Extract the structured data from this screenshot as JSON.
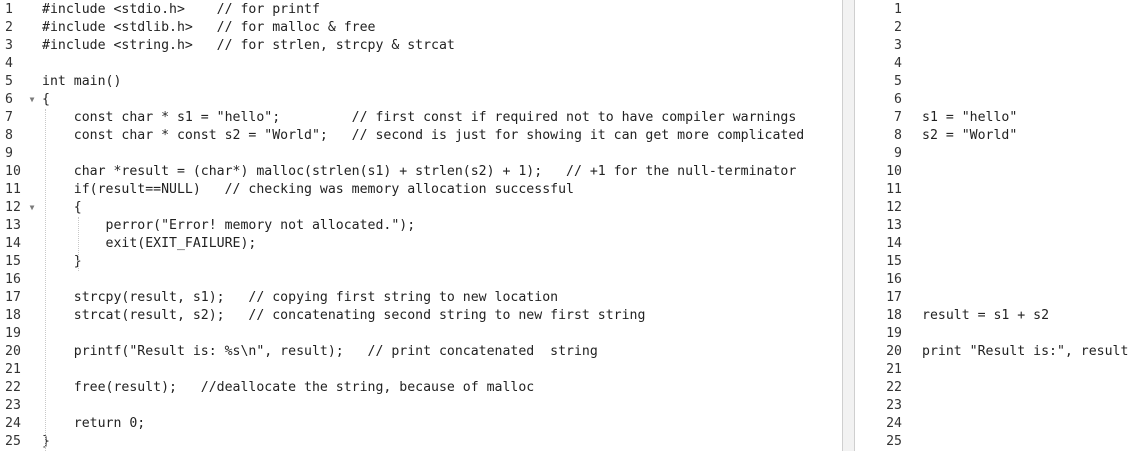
{
  "left_editor": {
    "lines": [
      {
        "num": "1",
        "text": "#include <stdio.h>    // for printf",
        "fold": ""
      },
      {
        "num": "2",
        "text": "#include <stdlib.h>   // for malloc & free",
        "fold": ""
      },
      {
        "num": "3",
        "text": "#include <string.h>   // for strlen, strcpy & strcat",
        "fold": ""
      },
      {
        "num": "4",
        "text": "",
        "fold": ""
      },
      {
        "num": "5",
        "text": "int main()",
        "fold": ""
      },
      {
        "num": "6",
        "text": "{",
        "fold": "▼"
      },
      {
        "num": "7",
        "text": "    const char * s1 = \"hello\";         // first const if required not to have compiler warnings",
        "fold": ""
      },
      {
        "num": "8",
        "text": "    const char * const s2 = \"World\";   // second is just for showing it can get more complicated",
        "fold": ""
      },
      {
        "num": "9",
        "text": "",
        "fold": ""
      },
      {
        "num": "10",
        "text": "    char *result = (char*) malloc(strlen(s1) + strlen(s2) + 1);   // +1 for the null-terminator",
        "fold": ""
      },
      {
        "num": "11",
        "text": "    if(result==NULL)   // checking was memory allocation successful",
        "fold": ""
      },
      {
        "num": "12",
        "text": "    {",
        "fold": "▼"
      },
      {
        "num": "13",
        "text": "        perror(\"Error! memory not allocated.\");",
        "fold": ""
      },
      {
        "num": "14",
        "text": "        exit(EXIT_FAILURE);",
        "fold": ""
      },
      {
        "num": "15",
        "text": "    }",
        "fold": ""
      },
      {
        "num": "16",
        "text": "",
        "fold": ""
      },
      {
        "num": "17",
        "text": "    strcpy(result, s1);   // copying first string to new location",
        "fold": ""
      },
      {
        "num": "18",
        "text": "    strcat(result, s2);   // concatenating second string to new first string",
        "fold": ""
      },
      {
        "num": "19",
        "text": "",
        "fold": ""
      },
      {
        "num": "20",
        "text": "    printf(\"Result is: %s\\n\", result);   // print concatenated  string",
        "fold": ""
      },
      {
        "num": "21",
        "text": "",
        "fold": ""
      },
      {
        "num": "22",
        "text": "    free(result);   //deallocate the string, because of malloc",
        "fold": ""
      },
      {
        "num": "23",
        "text": "",
        "fold": ""
      },
      {
        "num": "24",
        "text": "    return 0;",
        "fold": ""
      },
      {
        "num": "25",
        "text": "}",
        "fold": ""
      }
    ]
  },
  "right_editor": {
    "lines": [
      {
        "num": "1",
        "text": ""
      },
      {
        "num": "2",
        "text": ""
      },
      {
        "num": "3",
        "text": ""
      },
      {
        "num": "4",
        "text": ""
      },
      {
        "num": "5",
        "text": ""
      },
      {
        "num": "6",
        "text": ""
      },
      {
        "num": "7",
        "text": "s1 = \"hello\""
      },
      {
        "num": "8",
        "text": "s2 = \"World\""
      },
      {
        "num": "9",
        "text": ""
      },
      {
        "num": "10",
        "text": ""
      },
      {
        "num": "11",
        "text": ""
      },
      {
        "num": "12",
        "text": ""
      },
      {
        "num": "13",
        "text": ""
      },
      {
        "num": "14",
        "text": ""
      },
      {
        "num": "15",
        "text": ""
      },
      {
        "num": "16",
        "text": ""
      },
      {
        "num": "17",
        "text": ""
      },
      {
        "num": "18",
        "text": "result = s1 + s2"
      },
      {
        "num": "19",
        "text": ""
      },
      {
        "num": "20",
        "text": "print \"Result is:\", result"
      },
      {
        "num": "21",
        "text": ""
      },
      {
        "num": "22",
        "text": ""
      },
      {
        "num": "23",
        "text": ""
      },
      {
        "num": "24",
        "text": ""
      },
      {
        "num": "25",
        "text": ""
      }
    ]
  }
}
